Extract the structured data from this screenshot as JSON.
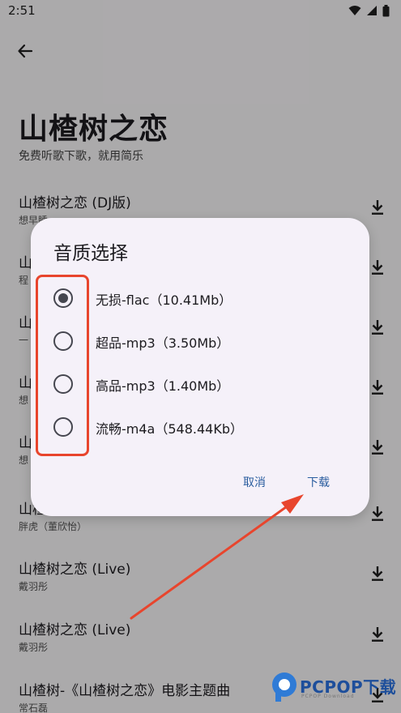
{
  "status_bar": {
    "time": "2:51"
  },
  "header": {
    "title": "山楂树之恋",
    "subtitle": "免费听歌下歌，就用简乐"
  },
  "songs": [
    {
      "title": "山楂树之恋 (DJ版)",
      "artist": "想早睡"
    },
    {
      "title": "山",
      "artist": "程"
    },
    {
      "title": "山",
      "artist": "一"
    },
    {
      "title": "山",
      "artist": "想"
    },
    {
      "title": "山",
      "artist": "想"
    },
    {
      "title": "山楂",
      "artist": "胖虎（董欣怡）"
    },
    {
      "title": "山楂树之恋 (Live)",
      "artist": "戴羽彤"
    },
    {
      "title": "山楂树之恋 (Live)",
      "artist": "戴羽彤"
    },
    {
      "title": "山楂树-《山楂树之恋》电影主题曲",
      "artist": "常石磊"
    }
  ],
  "dialog": {
    "title": "音质选择",
    "options": [
      {
        "label": "无损-flac（10.41Mb）",
        "selected": true
      },
      {
        "label": "超品-mp3（3.50Mb）",
        "selected": false
      },
      {
        "label": "高品-mp3（1.40Mb）",
        "selected": false
      },
      {
        "label": "流畅-m4a（548.44Kb）",
        "selected": false
      }
    ],
    "cancel_label": "取消",
    "download_label": "下载"
  },
  "watermark": {
    "brand": "PCPOP下载",
    "tagline": "PCPOP Download"
  },
  "colors": {
    "accent": "#2a5d9f",
    "annotation": "#e8452d"
  },
  "icons": {
    "back": "arrow-left-icon",
    "download": "download-icon",
    "wifi": "wifi-icon",
    "signal": "signal-icon",
    "battery": "battery-icon"
  }
}
